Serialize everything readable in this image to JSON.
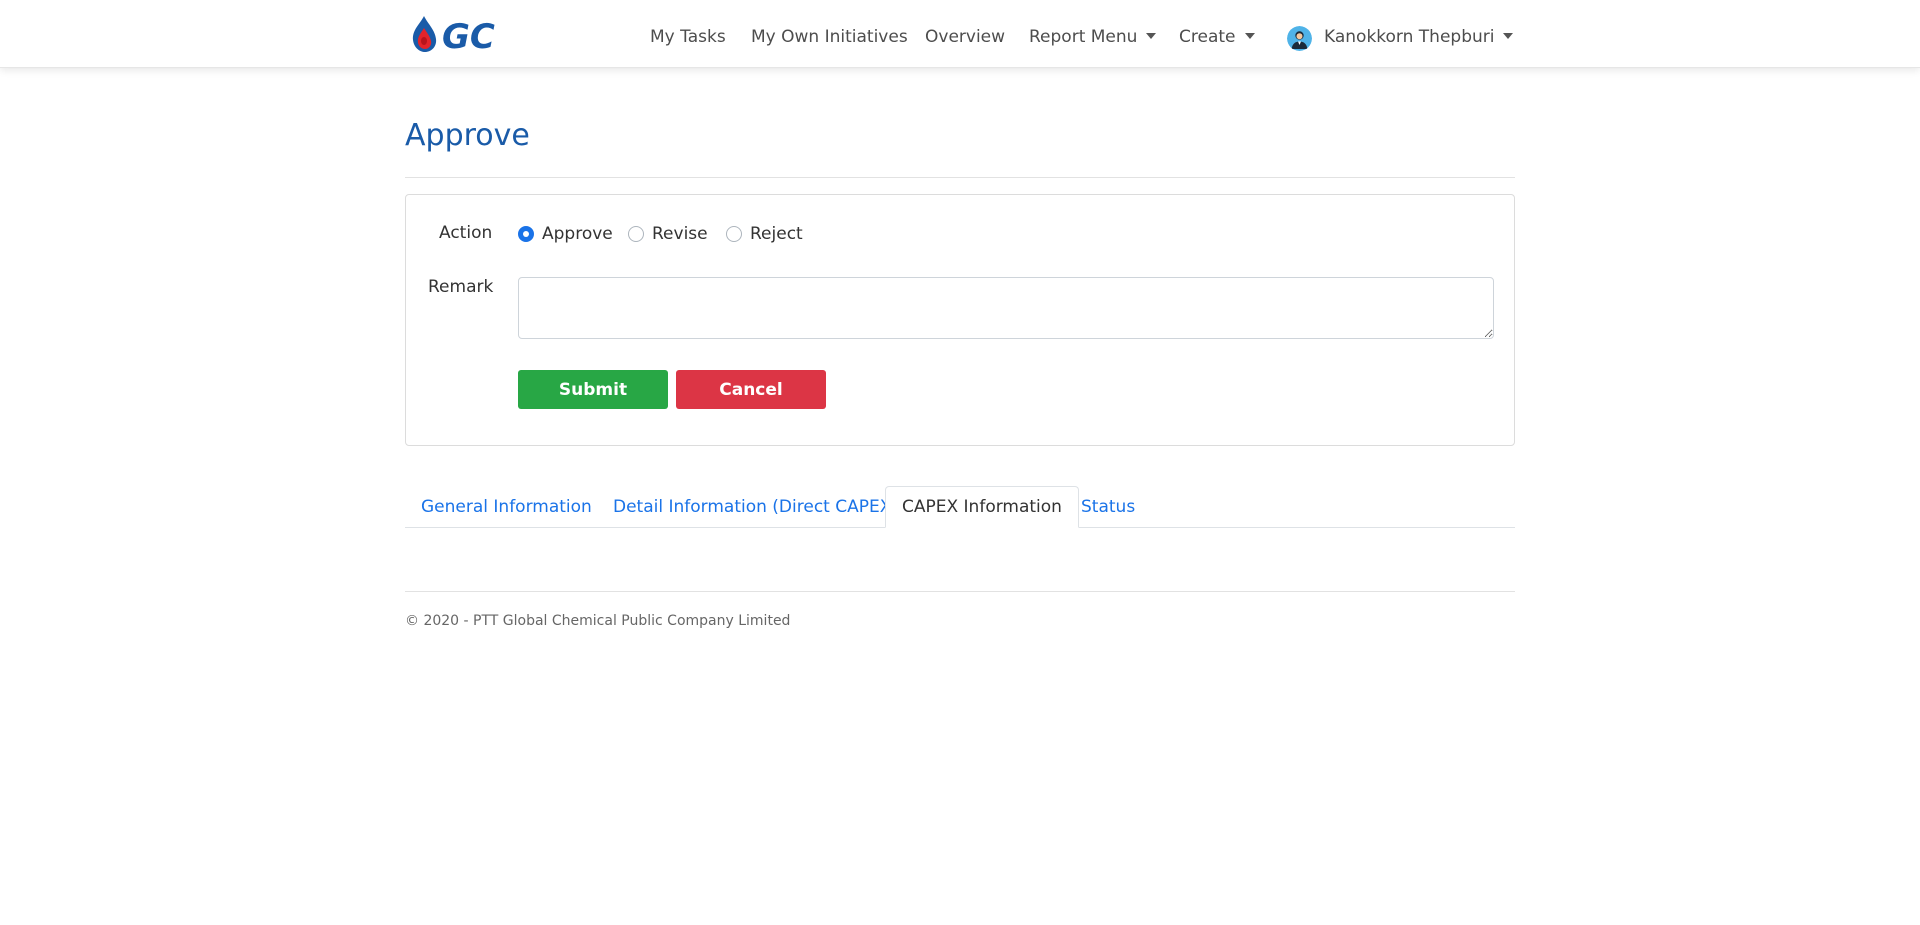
{
  "navbar": {
    "logo_text": "GC",
    "links": [
      "My Tasks",
      "My Own Initiatives",
      "Overview",
      "Report Menu",
      "Create"
    ],
    "user_name": "Kanokkorn Thepburi"
  },
  "page": {
    "title": "Approve"
  },
  "form": {
    "action_label": "Action",
    "action_options": [
      "Approve",
      "Revise",
      "Reject"
    ],
    "selected_action": "Approve",
    "remark_label": "Remark",
    "remark_value": "",
    "submit_label": "Submit",
    "cancel_label": "Cancel"
  },
  "tabs": {
    "items": [
      "General Information",
      "Detail Information (Direct CAPEX)",
      "CAPEX Information",
      "Status"
    ],
    "active": "CAPEX Information"
  },
  "footer": {
    "copyright": "© 2020 - PTT Global Chemical Public Company Limited"
  },
  "colors": {
    "title_blue": "#1a5ba8",
    "link_blue": "#1a73e8",
    "submit_green": "#28a745",
    "cancel_red": "#dc3545",
    "logo_blue": "#1a5ba8",
    "logo_drop_red": "#e3242b"
  }
}
